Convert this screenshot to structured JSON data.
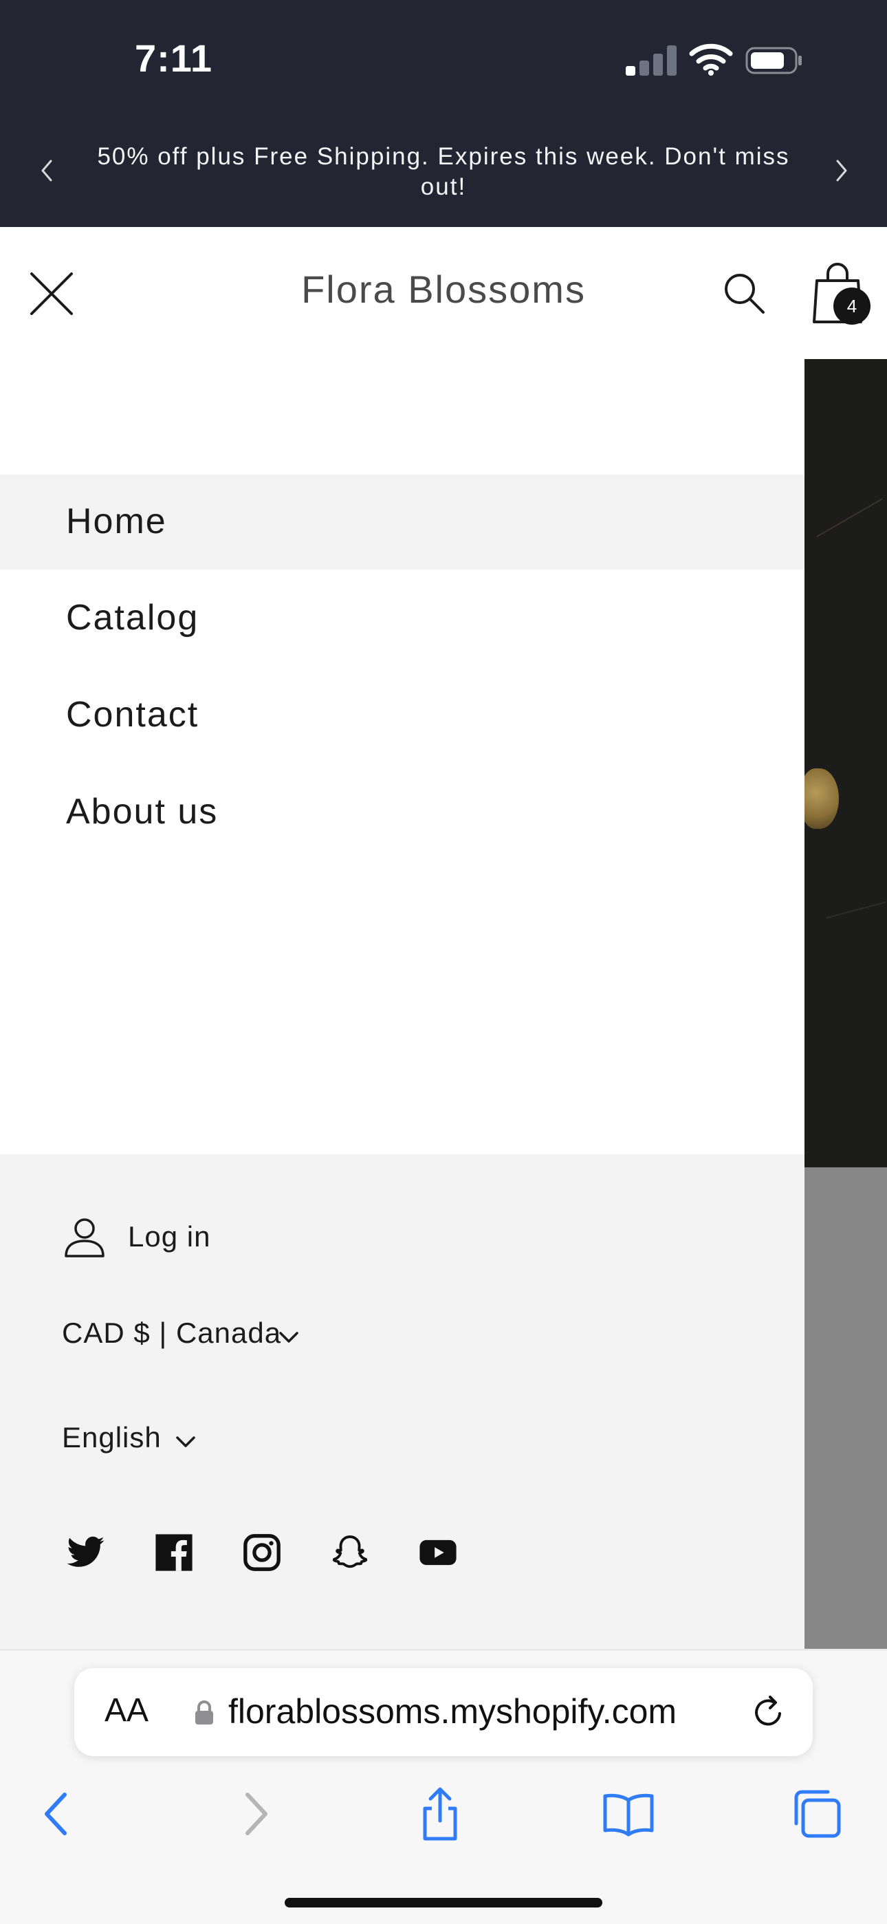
{
  "status_bar": {
    "time": "7:11",
    "signal_bars_active": 1,
    "signal_bars_total": 4
  },
  "announcement": {
    "text": "50% off plus Free Shipping. Expires this week. Don't miss out!",
    "prev_icon": "chevron-left-icon",
    "next_icon": "chevron-right-icon"
  },
  "header": {
    "store_name": "Flora Blossoms",
    "close_icon": "close-icon",
    "search_icon": "search-icon",
    "cart_icon": "shopping-bag-icon",
    "cart_count": "4"
  },
  "menu": {
    "items": [
      {
        "label": "Home",
        "active": true
      },
      {
        "label": "Catalog",
        "active": false
      },
      {
        "label": "Contact",
        "active": false
      },
      {
        "label": "About us",
        "active": false
      }
    ]
  },
  "footer": {
    "login_label": "Log in",
    "currency_selected": "CAD $ | Canada",
    "language_selected": "English",
    "social": [
      "twitter-icon",
      "facebook-icon",
      "instagram-icon",
      "snapchat-icon",
      "youtube-icon"
    ]
  },
  "browser": {
    "text_size_label": "AA",
    "url": "florablossoms.myshopify.com",
    "accent": "#2f7cf6",
    "disabled": "#b5b5b5"
  },
  "colors": {
    "top_bar": "#232533",
    "menu_active_bg": "#f3f3f3",
    "text": "#1b1b1b"
  }
}
